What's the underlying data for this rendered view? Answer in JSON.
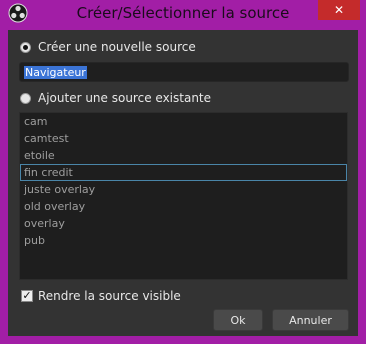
{
  "window": {
    "title": "Créer/Sélectionner la source"
  },
  "create_new": {
    "label": "Créer une nouvelle source",
    "selected": true
  },
  "name_input": {
    "value": "Navigateur"
  },
  "add_existing": {
    "label": "Ajouter une source existante",
    "selected": false
  },
  "sources": [
    {
      "label": "cam",
      "selected": false
    },
    {
      "label": "camtest",
      "selected": false
    },
    {
      "label": "etoile",
      "selected": false
    },
    {
      "label": "fin credit",
      "selected": true
    },
    {
      "label": "juste overlay",
      "selected": false
    },
    {
      "label": "old overlay",
      "selected": false
    },
    {
      "label": "overlay",
      "selected": false
    },
    {
      "label": "pub",
      "selected": false
    }
  ],
  "visible_checkbox": {
    "label": "Rendre la source visible",
    "checked": true
  },
  "buttons": {
    "ok": "Ok",
    "cancel": "Annuler"
  },
  "colors": {
    "window_border": "#a21ea6",
    "dialog_bg": "#333333",
    "list_bg": "#1e1e1e",
    "selection": "#3b74d6",
    "selected_item_border": "#4a85a8",
    "close_button": "#c42b2b"
  },
  "icons": {
    "app": "obs-logo-icon",
    "close": "close-icon"
  }
}
